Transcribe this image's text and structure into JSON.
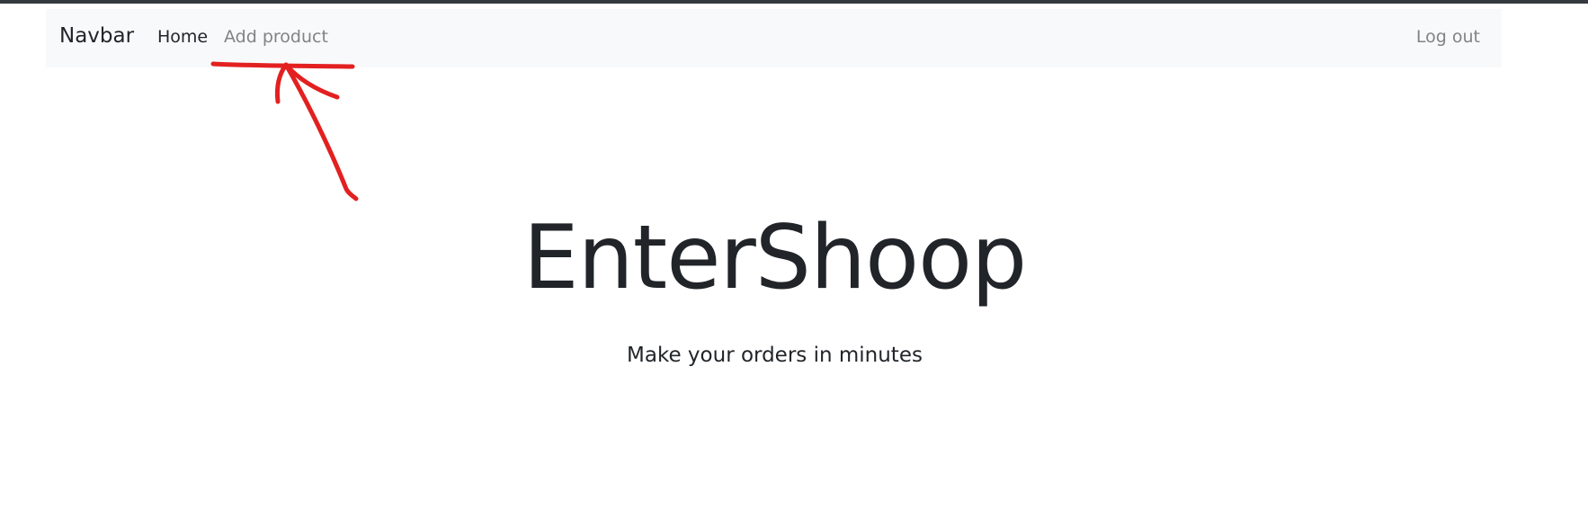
{
  "navbar": {
    "brand": "Navbar",
    "links": {
      "home": "Home",
      "add_product": "Add product",
      "log_out": "Log out"
    }
  },
  "hero": {
    "title": "EnterShoop",
    "subtitle": "Make your orders in minutes"
  },
  "annotation": {
    "color": "#e32020",
    "shape": "arrow-with-underline"
  }
}
